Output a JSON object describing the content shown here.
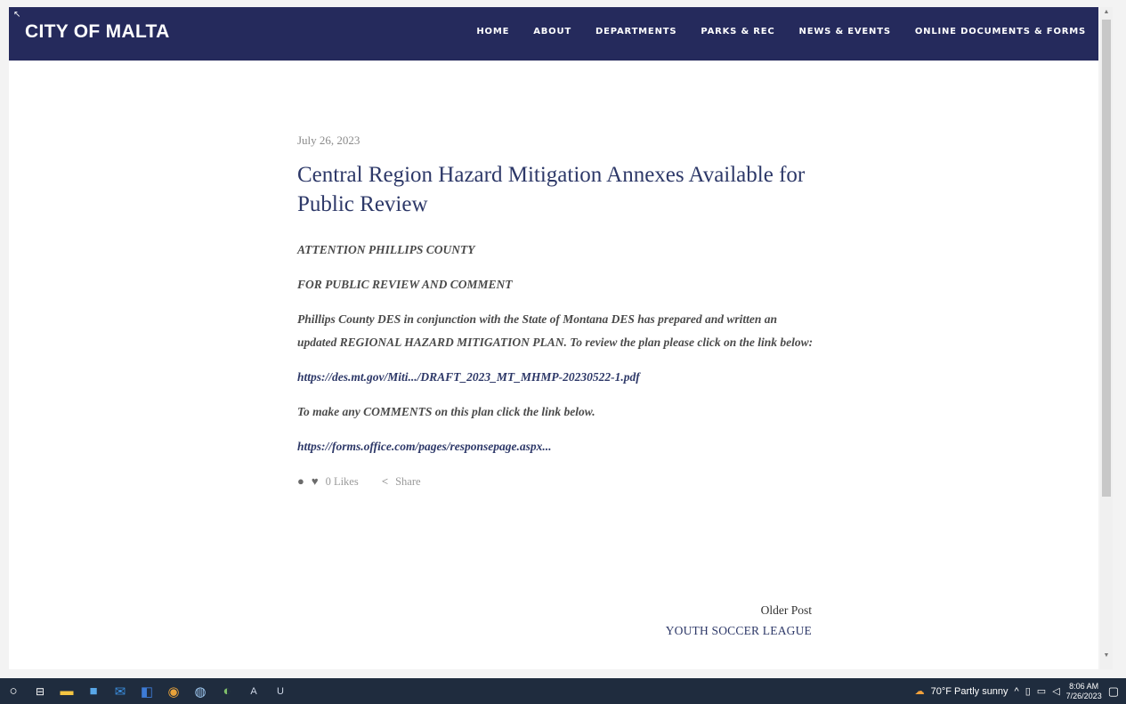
{
  "site": {
    "title": "CITY OF MALTA",
    "nav": [
      "HOME",
      "ABOUT",
      "DEPARTMENTS",
      "PARKS & REC",
      "NEWS & EVENTS",
      "ONLINE DOCUMENTS & FORMS"
    ]
  },
  "post": {
    "date": "July 26, 2023",
    "title": "Central Region Hazard Mitigation Annexes Available for Public Review",
    "p1": "ATTENTION PHILLIPS COUNTY",
    "p2": "FOR PUBLIC REVIEW AND COMMENT",
    "p3": "Phillips County DES in conjunction with the State of Montana DES has prepared and written an updated REGIONAL HAZARD MITIGATION PLAN. To review the plan please click on the link below:",
    "link1": "https://des.mt.gov/Miti.../DRAFT_2023_MT_MHMP-20230522-1.pdf",
    "p4": "To make any COMMENTS on this plan click the link below.",
    "link2": "https://forms.office.com/pages/responsepage.aspx...",
    "likes": "0 Likes",
    "share": "Share"
  },
  "pager": {
    "label": "Older Post",
    "title": "YOUTH SOCCER LEAGUE"
  },
  "taskbar": {
    "weather": "70°F  Partly sunny",
    "time": "8:06 AM",
    "date": "7/26/2023"
  },
  "colors": {
    "navbar": "#252a5c",
    "title": "#2d3868",
    "taskbar": "#1f2c3e"
  }
}
